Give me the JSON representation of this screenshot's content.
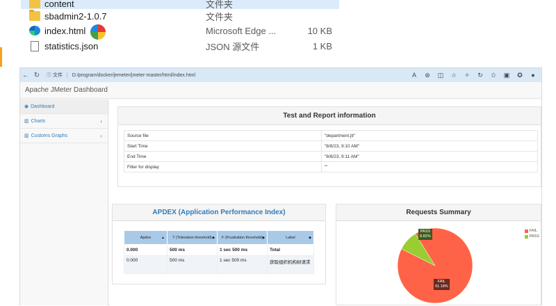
{
  "explorer": {
    "files": [
      {
        "name": "content",
        "type": "文件夹",
        "size": "",
        "icon": "folder-icon"
      },
      {
        "name": "sbadmin2-1.0.7",
        "type": "文件夹",
        "size": "",
        "icon": "folder-icon"
      },
      {
        "name": "index.html",
        "type": "Microsoft Edge ...",
        "size": "10 KB",
        "icon": "edge-icon"
      },
      {
        "name": "statistics.json",
        "type": "JSON 源文件",
        "size": "1 KB",
        "icon": "json-file-icon"
      }
    ]
  },
  "browser": {
    "address_label": "文件",
    "url": "D:/program/docker/jemeter/jmeter-master/html/index.html"
  },
  "app": {
    "title": "Apache JMeter Dashboard",
    "sidebar": [
      {
        "label": "Dashboard",
        "chevron": ""
      },
      {
        "label": "Charts",
        "chevron": "‹"
      },
      {
        "label": "Customs Graphs",
        "chevron": "‹"
      }
    ]
  },
  "info": {
    "title": "Test and Report information",
    "rows": [
      {
        "label": "Source file",
        "value": "\"department.jtl\""
      },
      {
        "label": "Start Time",
        "value": "\"8/8/23, 9:10 AM\""
      },
      {
        "label": "End Time",
        "value": "\"8/8/23, 9:11 AM\""
      },
      {
        "label": "Filter for display",
        "value": "\"\""
      }
    ]
  },
  "apdex": {
    "title": "APDEX (Application Performance Index)",
    "headers": [
      "Apdex",
      "T (Toleration threshold)",
      "F (Frustration threshold)",
      "Label"
    ],
    "rows": [
      [
        "0.000",
        "500 ms",
        "1 sec 500 ms",
        "Total"
      ],
      [
        "0.000",
        "500 ms",
        "1 sec 500 ms",
        "获取组织机构树请求"
      ]
    ]
  },
  "summary": {
    "title": "Requests Summary",
    "legend": [
      {
        "label": "FAIL",
        "color": "#ff6347"
      },
      {
        "label": "PASS",
        "color": "#9acd32"
      }
    ],
    "pass_label": "PASS",
    "pass_value": "8.82%",
    "fail_label": "FAIL",
    "fail_value": "91.18%"
  },
  "chart_data": {
    "type": "pie",
    "title": "Requests Summary",
    "categories": [
      "FAIL",
      "PASS"
    ],
    "values": [
      91.18,
      8.82
    ],
    "colors": [
      "#ff6347",
      "#9acd32"
    ]
  }
}
